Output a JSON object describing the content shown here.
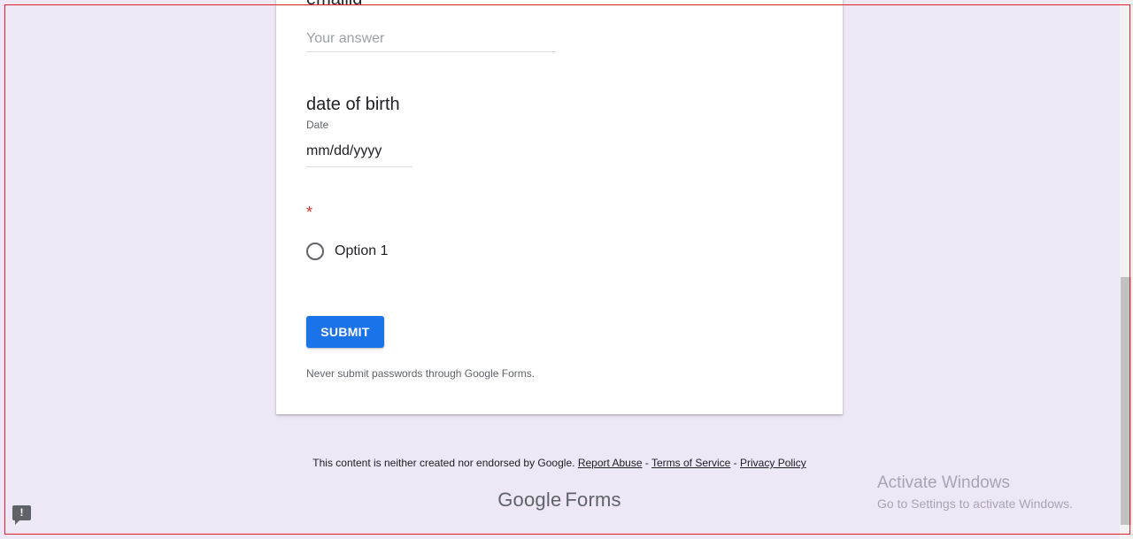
{
  "form": {
    "clipped_question_title": "emailid",
    "answer_placeholder": "Your answer",
    "dob_title": "date of birth",
    "dob_subtitle": "Date",
    "dob_value": "mm/dd/yyyy",
    "required_marker": "*",
    "radio_option_label": "Option 1",
    "submit_label": "SUBMIT",
    "password_warning": "Never submit passwords through Google Forms."
  },
  "footer": {
    "disclaimer": "This content is neither created nor endorsed by Google.",
    "report_abuse": "Report Abuse",
    "sep1": " - ",
    "terms": "Terms of Service",
    "sep2": " - ",
    "privacy": "Privacy Policy",
    "logo_google": "Google",
    "logo_forms": "Forms"
  },
  "watermark": {
    "line1": "Activate Windows",
    "line2": "Go to Settings to activate Windows."
  },
  "report_icon": {
    "icon": "feedback-report-icon",
    "glyph": "!"
  },
  "colors": {
    "background": "#ede7f6",
    "accent": "#1a73e8",
    "required": "#d93025"
  }
}
